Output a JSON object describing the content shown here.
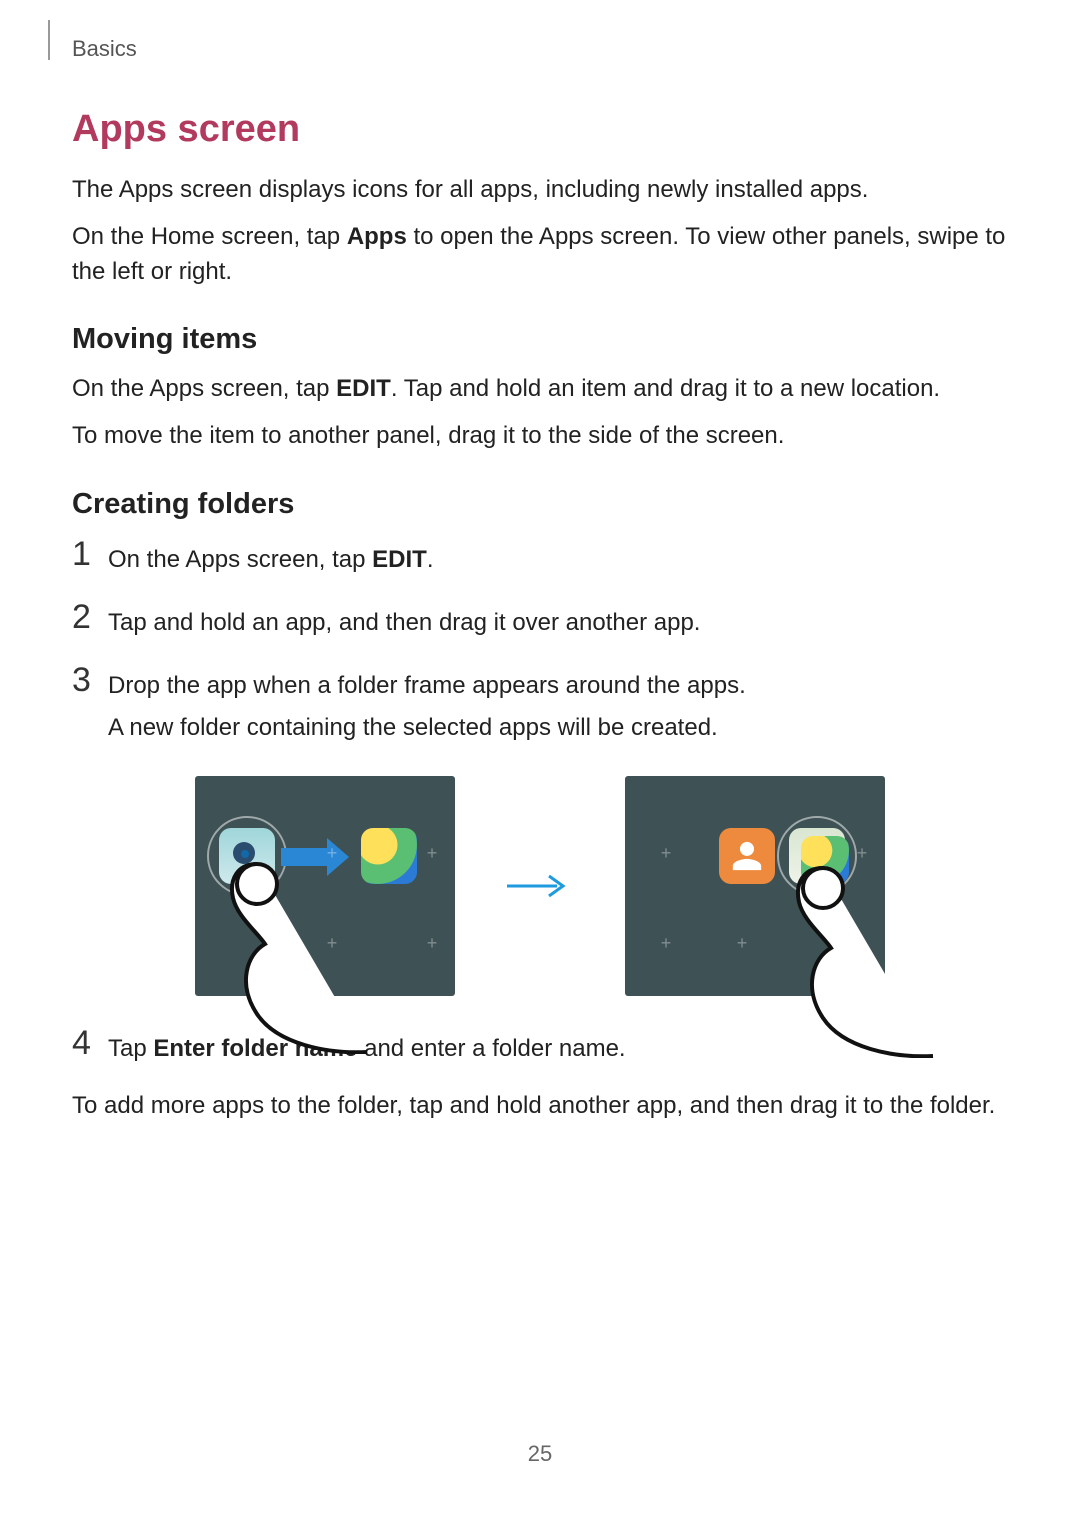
{
  "header": {
    "section": "Basics"
  },
  "title": "Apps screen",
  "intro1": "The Apps screen displays icons for all apps, including newly installed apps.",
  "intro2a": "On the Home screen, tap ",
  "intro2_bold": "Apps",
  "intro2b": " to open the Apps screen. To view other panels, swipe to the left or right.",
  "moving": {
    "heading": "Moving items",
    "p1a": "On the Apps screen, tap ",
    "p1_bold": "EDIT",
    "p1b": ". Tap and hold an item and drag it to a new location.",
    "p2": "To move the item to another panel, drag it to the side of the screen."
  },
  "creating": {
    "heading": "Creating folders",
    "steps": {
      "n1": "1",
      "s1a": "On the Apps screen, tap ",
      "s1_bold": "EDIT",
      "s1b": ".",
      "n2": "2",
      "s2": "Tap and hold an app, and then drag it over another app.",
      "n3": "3",
      "s3a": "Drop the app when a folder frame appears around the apps.",
      "s3b": "A new folder containing the selected apps will be created.",
      "n4": "4",
      "s4a": "Tap ",
      "s4_bold": "Enter folder name",
      "s4b": " and enter a folder name."
    }
  },
  "closing": "To add more apps to the folder, tap and hold another app, and then drag it to the folder.",
  "page_number": "25",
  "icons": {
    "camera": "camera-icon",
    "gallery": "gallery-icon",
    "contacts": "contacts-icon",
    "unknown": "app-icon"
  }
}
